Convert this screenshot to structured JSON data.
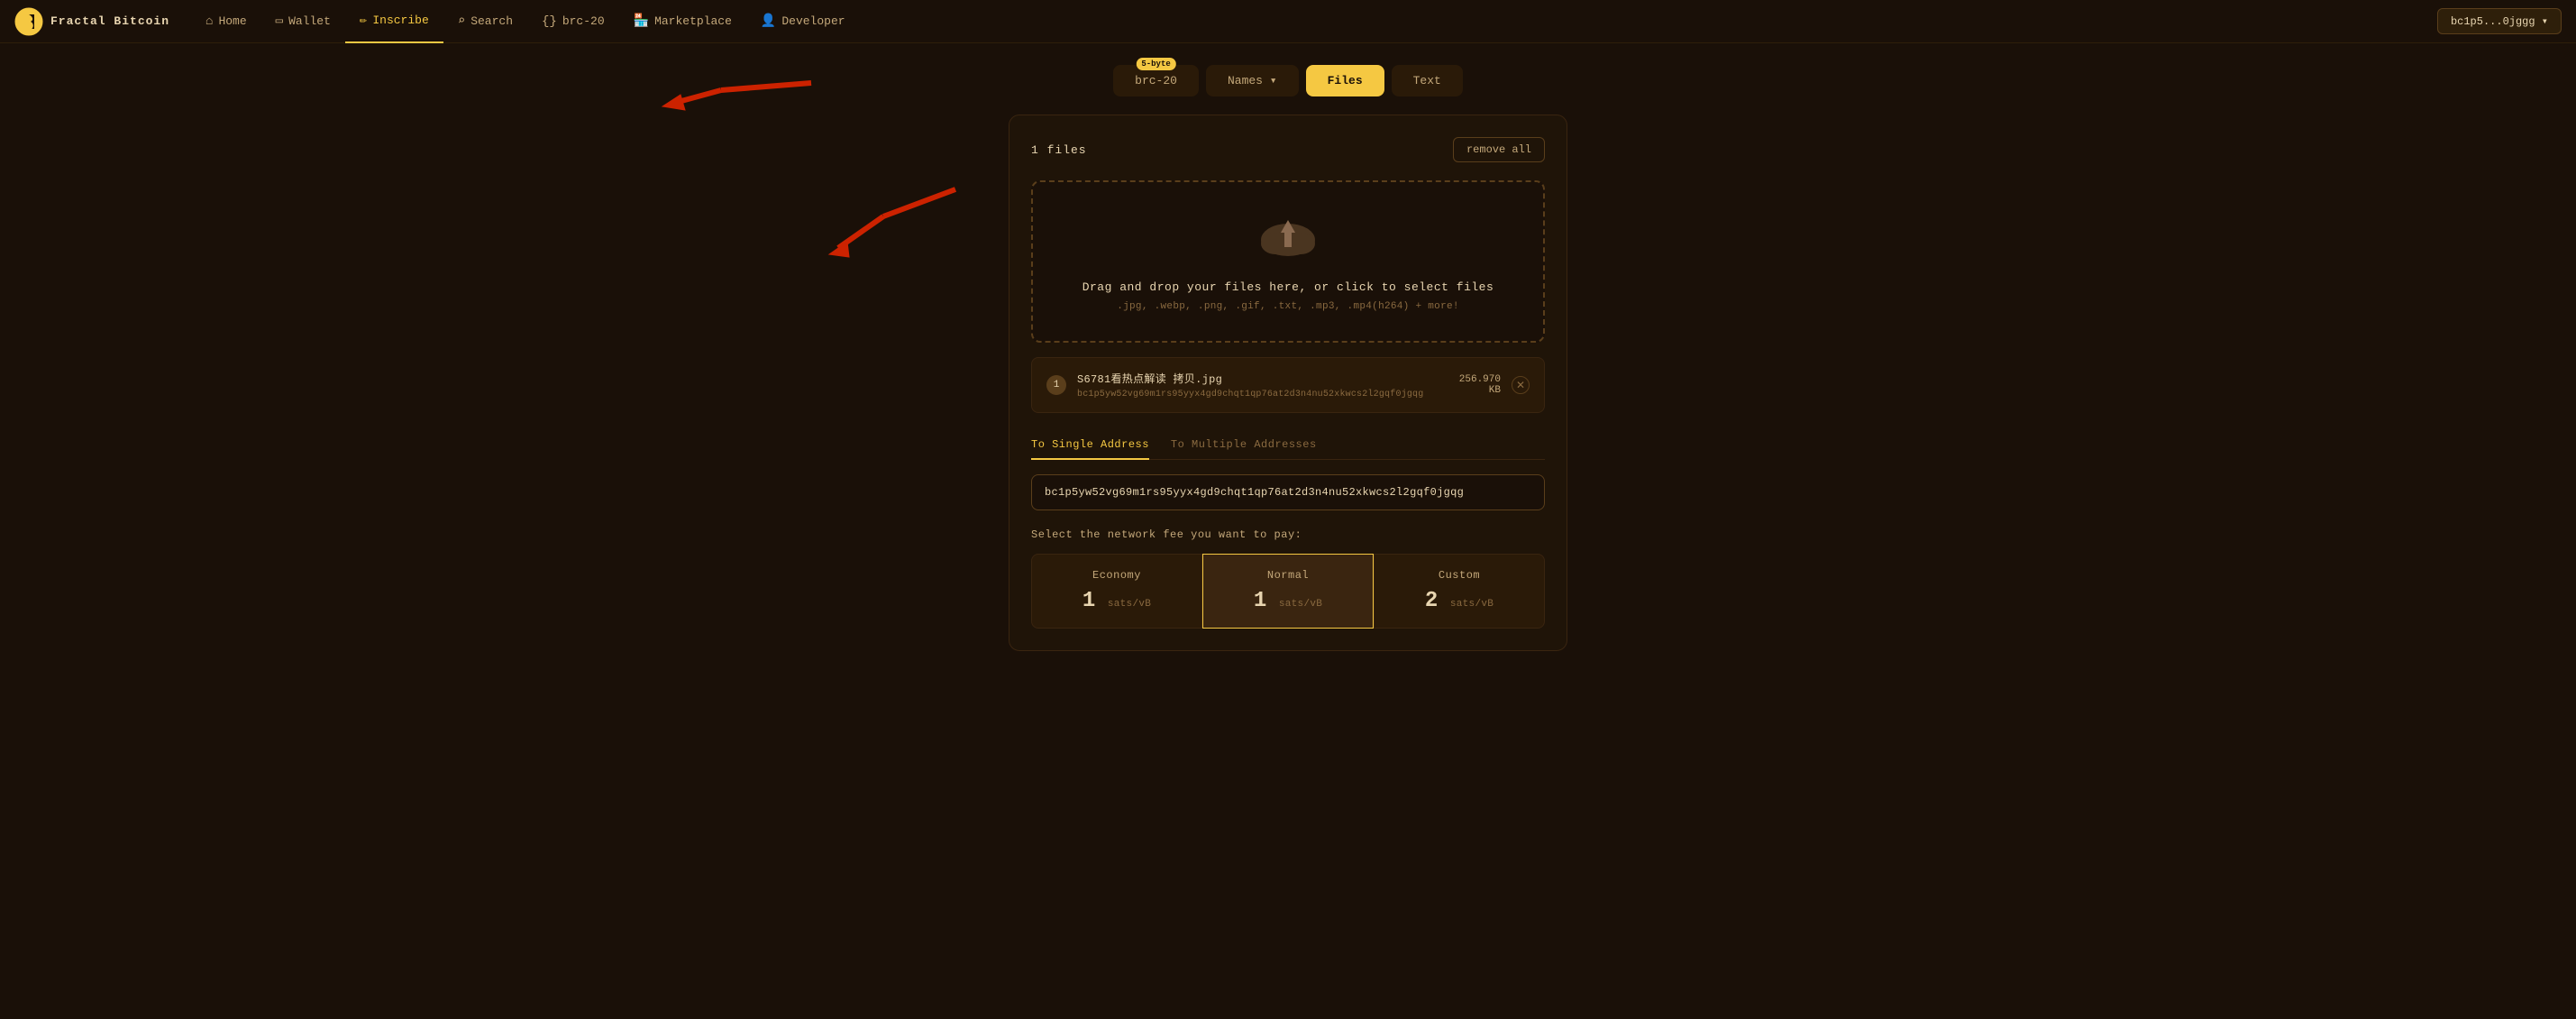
{
  "navbar": {
    "logo_text": "Fractal Bitcoin",
    "items": [
      {
        "id": "home",
        "label": "Home",
        "icon": "🏠",
        "active": false
      },
      {
        "id": "wallet",
        "label": "Wallet",
        "icon": "💳",
        "active": false
      },
      {
        "id": "inscribe",
        "label": "Inscribe",
        "icon": "✏️",
        "active": true
      },
      {
        "id": "search",
        "label": "Search",
        "icon": "🔍",
        "active": false
      },
      {
        "id": "brc20",
        "label": "brc-20",
        "icon": "{}",
        "active": false
      },
      {
        "id": "marketplace",
        "label": "Marketplace",
        "icon": "🏪",
        "active": false
      },
      {
        "id": "developer",
        "label": "Developer",
        "icon": "👤",
        "active": false
      }
    ],
    "wallet_btn": "bc1p5...0jggg ▾"
  },
  "tabs": [
    {
      "id": "brc20",
      "label": "brc-20",
      "badge": "5-byte",
      "active": false
    },
    {
      "id": "names",
      "label": "Names ▾",
      "active": false
    },
    {
      "id": "files",
      "label": "Files",
      "active": true
    },
    {
      "id": "text",
      "label": "Text",
      "active": false
    }
  ],
  "panel": {
    "file_count": "1 files",
    "remove_all": "remove all",
    "dropzone": {
      "text": "Drag and drop your files here, or click to select files",
      "formats": ".jpg, .webp, .png, .gif, .txt, .mp3, .mp4(h264) + more!"
    },
    "file": {
      "index": "1",
      "name": "S6781看热点解读 拷贝.jpg",
      "address": "bc1p5yw52vg69m1rs95yyx4gd9chqt1qp76at2d3n4nu52xkwcs2l2gqf0jgqg",
      "size": "256.970",
      "size_unit": "KB"
    },
    "address_tabs": [
      {
        "label": "To Single Address",
        "active": true
      },
      {
        "label": "To Multiple Addresses",
        "active": false
      }
    ],
    "address_value": "bc1p5yw52vg69m1rs95yyx4gd9chqt1qp76at2d3n4nu52xkwcs2l2gqf0jgqg",
    "fee_label": "Select the network fee you want to pay:",
    "fee_cards": [
      {
        "id": "economy",
        "label": "Economy",
        "value": "1",
        "unit": "sats/vB",
        "active": false
      },
      {
        "id": "normal",
        "label": "Normal",
        "value": "1",
        "unit": "sats/vB",
        "active": true
      },
      {
        "id": "custom",
        "label": "Custom",
        "value": "2",
        "unit": "sats/vB",
        "active": false
      }
    ]
  }
}
